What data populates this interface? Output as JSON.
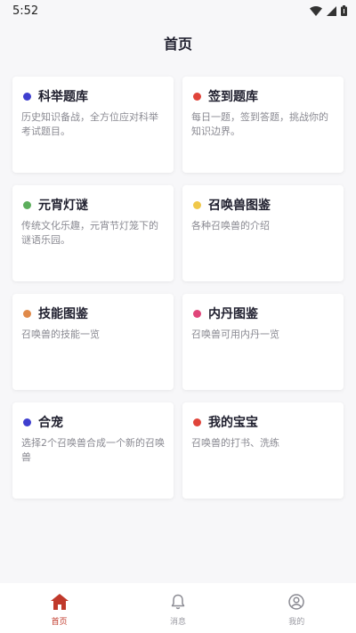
{
  "status_bar": {
    "time": "5:52",
    "icons": [
      "wifi-icon",
      "signal-icon",
      "battery-icon"
    ]
  },
  "header": {
    "title": "首页"
  },
  "cards": [
    {
      "title": "科举题库",
      "desc": "历史知识备战，全方位应对科举考试题目。",
      "color": "#3f3fcf",
      "icon": "bullet-dot-icon"
    },
    {
      "title": "签到题库",
      "desc": "每日一题，签到答题，挑战你的知识边界。",
      "color": "#e0443a",
      "icon": "bullet-dot-icon"
    },
    {
      "title": "元宵灯谜",
      "desc": "传统文化乐趣，元宵节灯笼下的谜语乐园。",
      "color": "#5cae5c",
      "icon": "bullet-dot-icon"
    },
    {
      "title": "召唤兽图鉴",
      "desc": "各种召唤兽的介绍",
      "color": "#f0c84a",
      "icon": "bullet-dot-icon"
    },
    {
      "title": "技能图鉴",
      "desc": "召唤兽的技能一览",
      "color": "#e08a4a",
      "icon": "bullet-dot-icon"
    },
    {
      "title": "内丹图鉴",
      "desc": "召唤兽可用内丹一览",
      "color": "#e0457a",
      "icon": "bullet-dot-icon"
    },
    {
      "title": "合宠",
      "desc": "选择2个召唤兽合成一个新的召唤兽",
      "color": "#3f3fcf",
      "icon": "bullet-dot-icon"
    },
    {
      "title": "我的宝宝",
      "desc": "召唤兽的打书、洗练",
      "color": "#e0443a",
      "icon": "bullet-dot-icon"
    }
  ],
  "tabbar": {
    "active_color": "#c0392b",
    "inactive_color": "#9a9aa2",
    "tabs": [
      {
        "label": "首页",
        "icon": "home-icon",
        "active": true
      },
      {
        "label": "消息",
        "icon": "bell-icon",
        "active": false
      },
      {
        "label": "我的",
        "icon": "user-circle-icon",
        "active": false
      }
    ]
  }
}
